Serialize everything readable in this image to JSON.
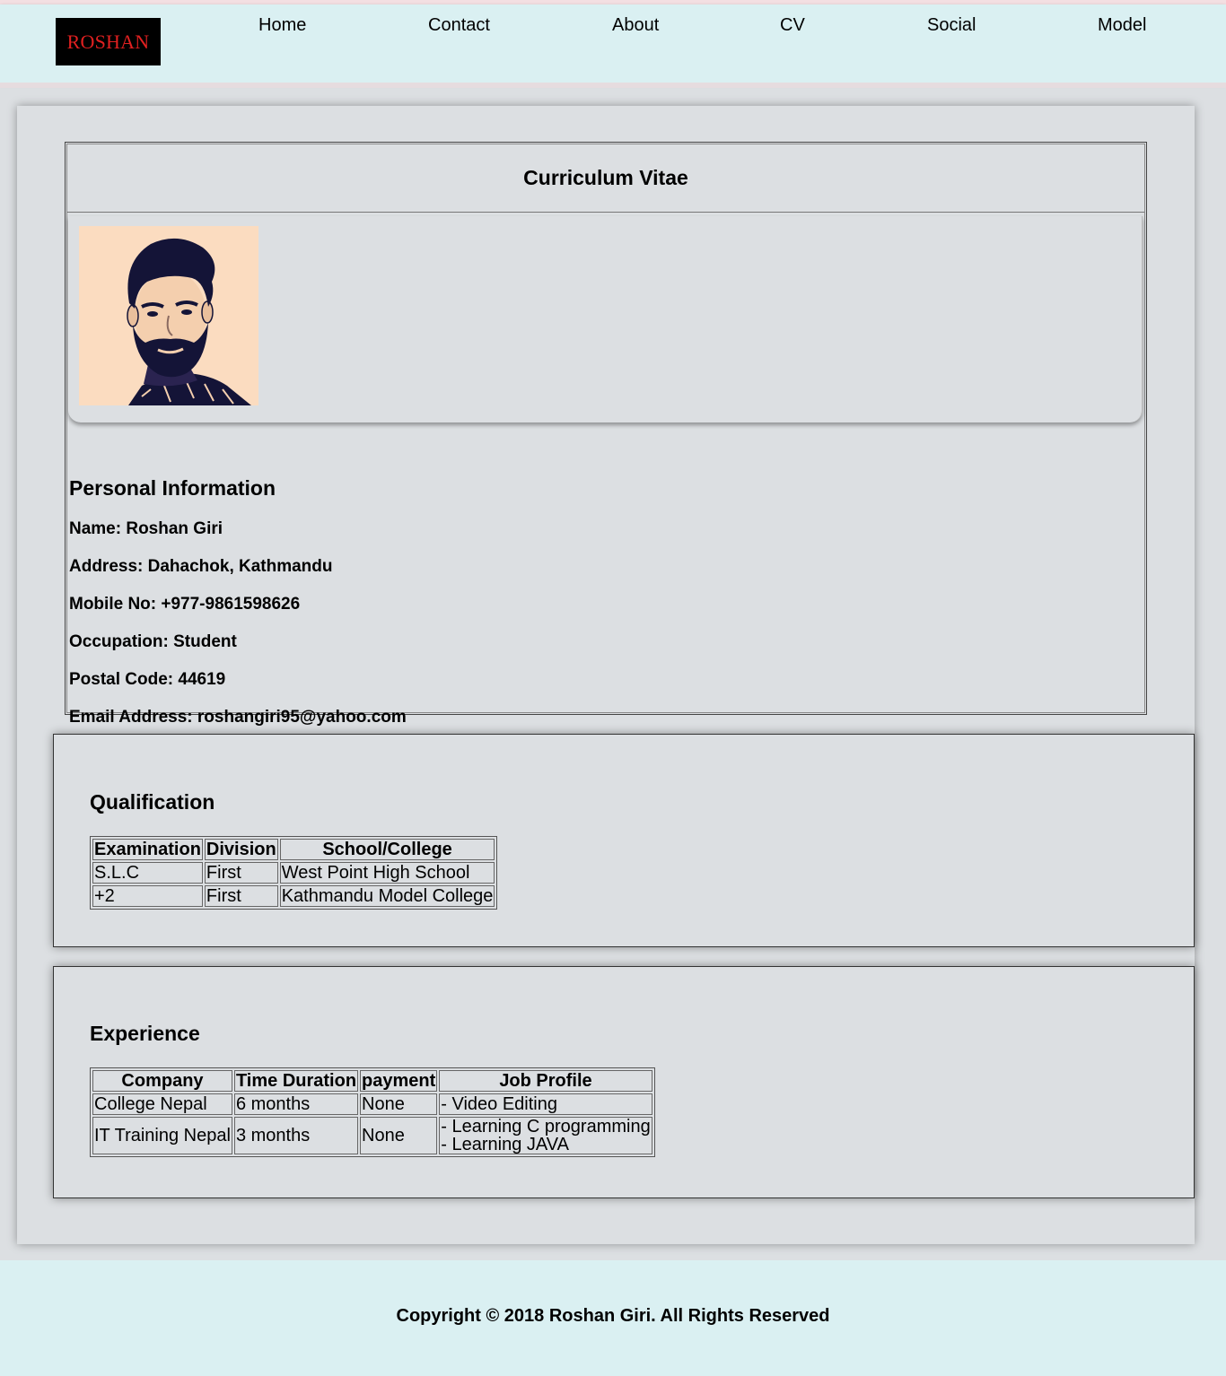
{
  "brand": {
    "logo_text": "ROSHAN"
  },
  "nav": {
    "items": [
      {
        "label": "Home"
      },
      {
        "label": "Contact"
      },
      {
        "label": "About"
      },
      {
        "label": "CV"
      },
      {
        "label": "Social"
      },
      {
        "label": "Model"
      }
    ]
  },
  "cv": {
    "title": "Curriculum Vitae",
    "personal": {
      "heading": "Personal Information",
      "lines": [
        "Name: Roshan Giri",
        "Address: Dahachok, Kathmandu",
        "Mobile No: +977-9861598626",
        "Occupation: Student",
        "Postal Code: 44619",
        "Email Address: roshangiri95@yahoo.com"
      ]
    }
  },
  "qualification": {
    "heading": "Qualification",
    "headers": [
      "Examination",
      "Division",
      "School/College"
    ],
    "rows": [
      [
        "S.L.C",
        "First",
        "West Point High School"
      ],
      [
        "+2",
        "First",
        "Kathmandu Model College"
      ]
    ]
  },
  "experience": {
    "heading": "Experience",
    "headers": [
      "Company",
      "Time Duration",
      "payment",
      "Job Profile"
    ],
    "rows": [
      {
        "company": "College Nepal",
        "duration": "6 months",
        "payment": "None",
        "profile": [
          "- Video Editing"
        ]
      },
      {
        "company": "IT Training Nepal",
        "duration": "3 months",
        "payment": "None",
        "profile": [
          "- Learning C programming",
          "- Learning JAVA"
        ]
      }
    ]
  },
  "footer": {
    "text": "Copyright © 2018 Roshan Giri. All Rights Reserved"
  },
  "colors": {
    "nav_bg": "#daf0f2",
    "page_bg": "#dcdfe2",
    "logo_bg": "#000000",
    "logo_text": "#e02020",
    "photo_bg": "#fbdcc0",
    "photo_ink": "#141437"
  }
}
